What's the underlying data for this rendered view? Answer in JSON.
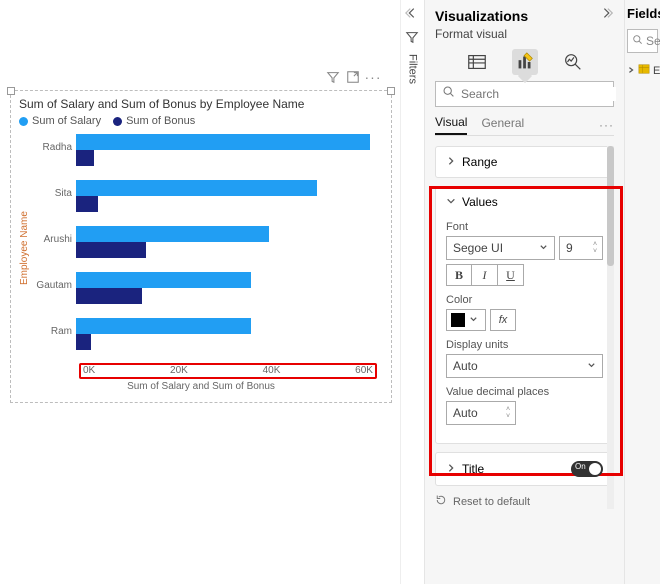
{
  "canvas": {
    "tools": {
      "filter": "filter-icon",
      "focus": "focus-mode-icon",
      "more": "more-icon"
    }
  },
  "chart_data": {
    "type": "bar",
    "orientation": "horizontal",
    "title": "Sum of Salary and Sum of Bonus by Employee Name",
    "ylabel": "Employee Name",
    "xlabel": "Sum of Salary and Sum of Bonus",
    "xlim": [
      0,
      70000
    ],
    "xticks": [
      "0K",
      "20K",
      "40K",
      "60K"
    ],
    "categories": [
      "Radha",
      "Sita",
      "Arushi",
      "Gautam",
      "Ram"
    ],
    "series": [
      {
        "name": "Sum of Salary",
        "color": "#219ef3",
        "values": [
          67000,
          55000,
          44000,
          40000,
          40000
        ]
      },
      {
        "name": "Sum of Bonus",
        "color": "#1a237e",
        "values": [
          4000,
          5000,
          16000,
          15000,
          3500
        ]
      }
    ]
  },
  "filters_rail": {
    "label": "Filters"
  },
  "viz_panel": {
    "title": "Visualizations",
    "subtitle": "Format visual",
    "search_placeholder": "Search",
    "tabs": {
      "visual": "Visual",
      "general": "General"
    },
    "cards": {
      "range": "Range",
      "values": {
        "title": "Values",
        "font_label": "Font",
        "font_family": "Segoe UI",
        "font_size": "9",
        "bold": "B",
        "italic": "I",
        "underline": "U",
        "color_label": "Color",
        "display_units_label": "Display units",
        "display_units_value": "Auto",
        "decimal_label": "Value decimal places",
        "decimal_value": "Auto"
      },
      "title_card": {
        "label": "Title",
        "toggle": "On"
      }
    },
    "reset": "Reset to default"
  },
  "fields_panel": {
    "title": "Fields",
    "search_hint": "Se",
    "table_hint": "E"
  }
}
